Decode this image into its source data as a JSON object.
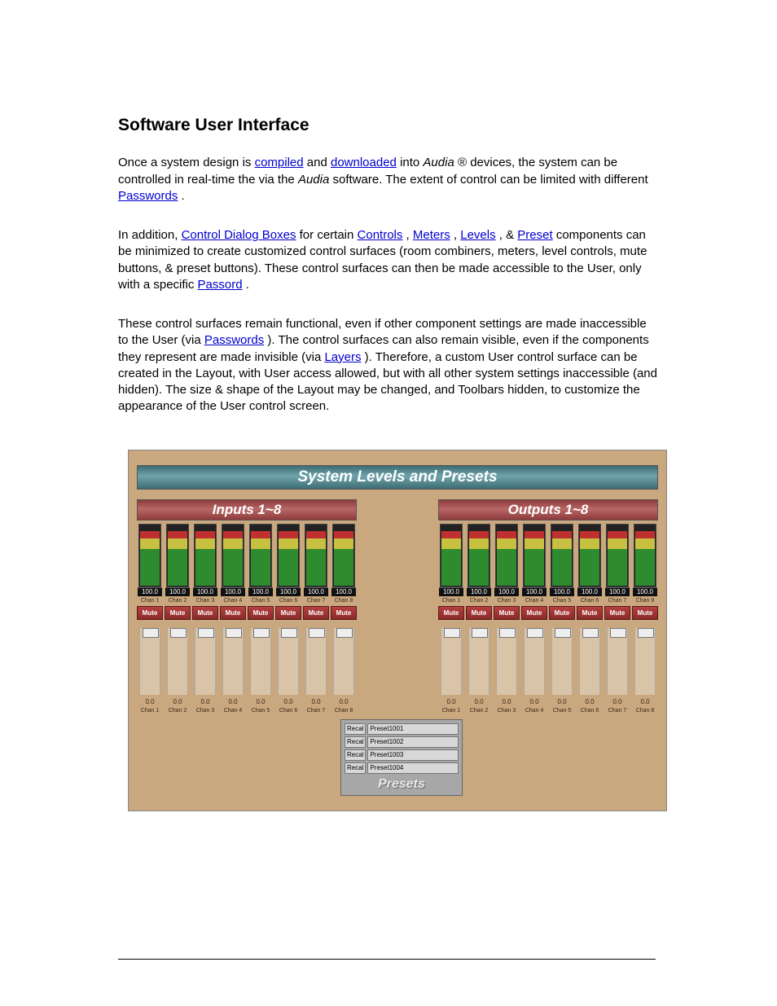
{
  "heading": "Software User Interface",
  "p1": {
    "t1": "Once a system design is ",
    "link1": "compiled",
    "t2": " and ",
    "link2": "downloaded",
    "t3": " into ",
    "brand": "Audia",
    "t4": "® devices, the system can be controlled in real-time the via the ",
    "brand2": "Audia",
    "t5": " software. The extent of control can be limited with different ",
    "link3": "Passwords",
    "t6": "."
  },
  "p2": {
    "t1": "In addition, ",
    "link1": "Control Dialog Boxes",
    "t2": " for certain ",
    "link2": "Controls",
    "t3": ", ",
    "link3": "Meters",
    "t4": ", ",
    "link4": "Levels",
    "t5": ", & ",
    "link5": "Preset",
    "t6": " components can be minimized to create customized control surfaces (room combiners, meters, level controls, mute buttons, & preset buttons). These control surfaces can then be made accessible to the User, only with a specific ",
    "link6": "Passord",
    "t7": "."
  },
  "p3": {
    "t1": "These control surfaces remain functional, even if other component settings are made inaccessible to the User (via ",
    "link1": "Passwords",
    "t2": "). The control surfaces can also remain visible, even if the components they represent are made invisible (via ",
    "link2": "Layers",
    "t3": "). Therefore, a custom User control surface can be created in the Layout, with User access allowed, but with all other system settings inaccessible (and hidden). The size & shape of the Layout may be changed, and Toolbars hidden, to customize the appearance of the User control screen."
  },
  "ui": {
    "main_title": "System Levels and Presets",
    "inputs_title": "Inputs 1~8",
    "outputs_title": "Outputs 1~8",
    "meter_value": "100.0",
    "mute_label": "Mute",
    "chan_prefix": "Chan  ",
    "fader_value": "0.0",
    "channels": [
      "1",
      "2",
      "3",
      "4",
      "5",
      "6",
      "7",
      "8"
    ],
    "presets_title": "Presets",
    "recall": "Recal",
    "presets": [
      "Preset1001",
      "Preset1002",
      "Preset1003",
      "Preset1004"
    ]
  }
}
